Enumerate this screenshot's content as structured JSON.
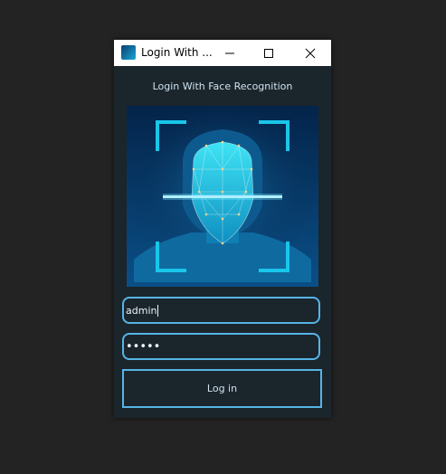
{
  "window": {
    "title": "Login With ...",
    "icons": {
      "app": "face-app-icon",
      "minimize": "minimize-icon",
      "maximize": "maximize-icon",
      "close": "close-icon"
    }
  },
  "main": {
    "heading": "Login With Face Recognition",
    "image": "face-recognition-scan-illustration"
  },
  "form": {
    "username_value": "admin",
    "password_mask": "•••••",
    "login_label": "Log in"
  },
  "colors": {
    "window_bg": "#1b252c",
    "desktop_bg": "#232323",
    "accent_border": "#56b4e6",
    "face_cyan": "#1ad0ee"
  }
}
